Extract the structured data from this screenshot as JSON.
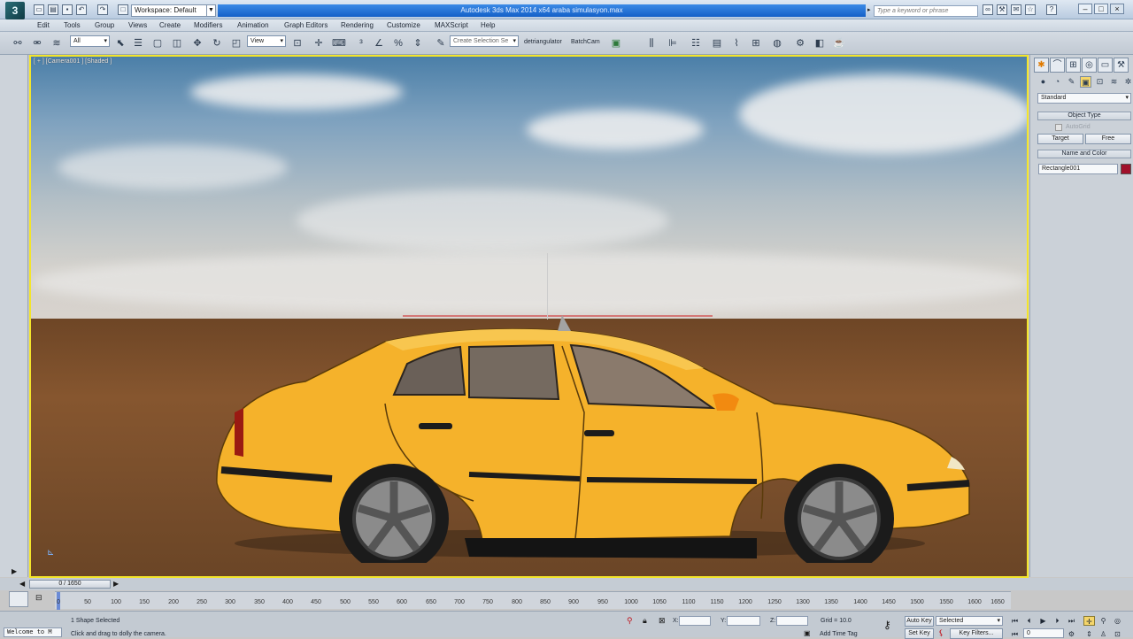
{
  "title_bar": {
    "workspace": "Workspace: Default",
    "title": "Autodesk 3ds Max 2014 x64     araba simulasyon.max",
    "search_placeholder": "Type a keyword or phrase"
  },
  "menu": [
    "Edit",
    "Tools",
    "Group",
    "Views",
    "Create",
    "Modifiers",
    "Animation",
    "Graph Editors",
    "Rendering",
    "Customize",
    "MAXScript",
    "Help"
  ],
  "toolbar": {
    "selection_filter": "All",
    "reference_coord": "View",
    "named_selection": "Create Selection Se",
    "detriangulator": "detriangulator",
    "batchcam": "BatchCam"
  },
  "viewport": {
    "label": "[ + ] [Camera001 ] [Shaded ]"
  },
  "command_panel": {
    "dropdown": "Standard",
    "object_type_header": "Object Type",
    "autogrid": "AutoGrid",
    "target_btn": "Target",
    "free_btn": "Free",
    "name_color_header": "Name and Color",
    "name_value": "Rectangle001",
    "color_swatch": "#a0102a"
  },
  "timeline": {
    "slider": "0 / 1650",
    "ticks": [
      "0",
      "50",
      "100",
      "150",
      "200",
      "250",
      "300",
      "350",
      "400",
      "450",
      "500",
      "550",
      "600",
      "650",
      "700",
      "750",
      "800",
      "850",
      "900",
      "950",
      "1000",
      "1050",
      "1100",
      "1150",
      "1200",
      "1250",
      "1300",
      "1350",
      "1400",
      "1450",
      "1500",
      "1550",
      "1600",
      "1650"
    ]
  },
  "status": {
    "maxscript": "Welcome to M",
    "selection": "1 Shape Selected",
    "prompt": "Click and drag to dolly the camera.",
    "x_label": "X:",
    "y_label": "Y:",
    "z_label": "Z:",
    "grid": "Grid = 10.0",
    "auto_key": "Auto Key",
    "key_mode": "Selected",
    "set_key": "Set Key",
    "key_filters": "Key Filters...",
    "add_time_tag": "Add Time Tag",
    "frame": "0"
  }
}
